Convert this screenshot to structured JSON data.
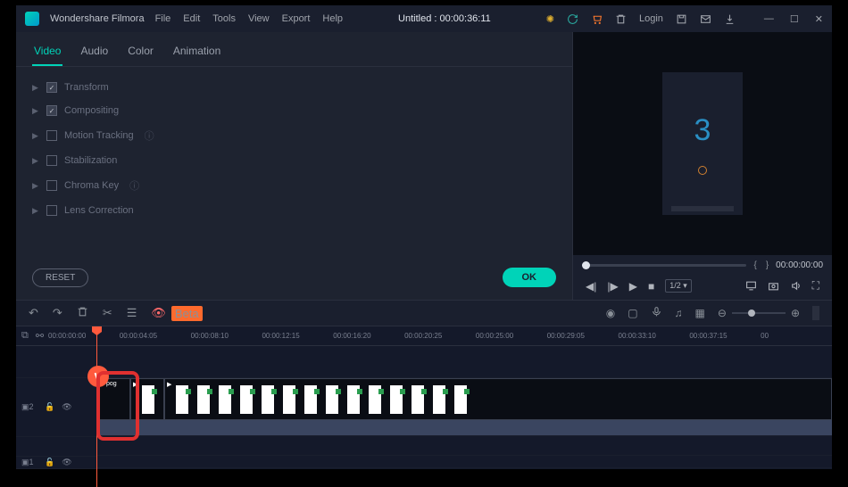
{
  "app": {
    "name": "Wondershare Filmora",
    "title": "Untitled : 00:00:36:11"
  },
  "menus": [
    "File",
    "Edit",
    "Tools",
    "View",
    "Export",
    "Help"
  ],
  "titlebar": {
    "login": "Login"
  },
  "tabs": [
    "Video",
    "Audio",
    "Color",
    "Animation"
  ],
  "props": [
    {
      "label": "Transform",
      "checked": true,
      "help": false
    },
    {
      "label": "Compositing",
      "checked": true,
      "help": false
    },
    {
      "label": "Motion Tracking",
      "checked": false,
      "help": true
    },
    {
      "label": "Stabilization",
      "checked": false,
      "help": false
    },
    {
      "label": "Chroma Key",
      "checked": false,
      "help": true
    },
    {
      "label": "Lens Correction",
      "checked": false,
      "help": false
    }
  ],
  "buttons": {
    "reset": "RESET",
    "ok": "OK"
  },
  "preview": {
    "number": "3",
    "timecode": "00:00:00:00",
    "open_brace": "{",
    "close_brace": "}",
    "speed": "1/2 ▾"
  },
  "toolbar2": {
    "beta": "Beta"
  },
  "ruler": {
    "marks": [
      "00:00:00:00",
      "00:00:04:05",
      "00:00:08:10",
      "00:00:12:15",
      "00:00:16:20",
      "00:00:20:25",
      "00:00:25:00",
      "00:00:29:05",
      "00:00:33:10",
      "00:00:37:15",
      "00"
    ]
  },
  "tracks": {
    "t2": "2",
    "t1": "1",
    "clip_label": "pog"
  }
}
